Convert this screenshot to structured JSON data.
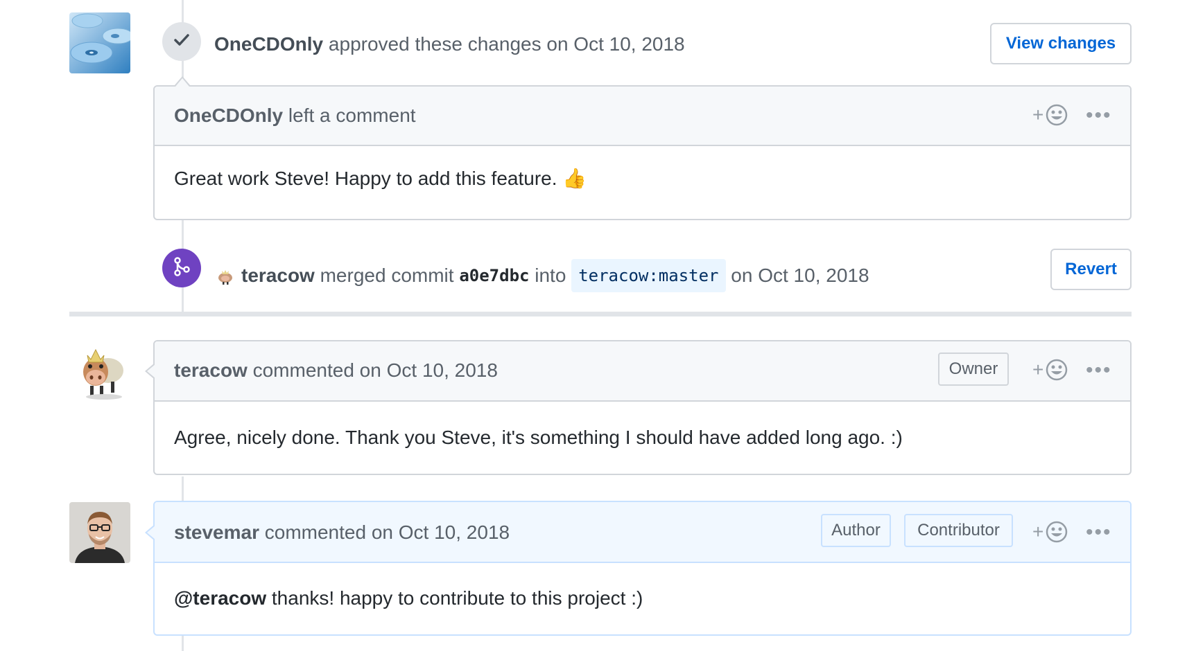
{
  "review": {
    "user": "OneCDOnly",
    "action_text": "approved these changes on Oct 10, 2018",
    "view_changes_label": "View changes"
  },
  "review_comment": {
    "user": "OneCDOnly",
    "head_text": "left a comment",
    "body": "Great work Steve! Happy to add this feature.",
    "emoji": "👍"
  },
  "merge_event": {
    "user": "teracow",
    "text_merged": "merged commit",
    "sha": "a0e7dbc",
    "text_into": "into",
    "branch": "teracow:master",
    "date_text": "on Oct 10, 2018",
    "revert_label": "Revert"
  },
  "comments": [
    {
      "user": "teracow",
      "meta": "commented on Oct 10, 2018",
      "labels": [
        "Owner"
      ],
      "body": "Agree, nicely done. Thank you Steve, it's something I should have added long ago. :)"
    },
    {
      "user": "stevemar",
      "meta": "commented on Oct 10, 2018",
      "labels": [
        "Author",
        "Contributor"
      ],
      "mention": "@teracow",
      "body": "thanks! happy to contribute to this project :)"
    }
  ],
  "icons": {
    "reaction": "add-reaction-icon",
    "more": "more-options-icon",
    "check": "check-icon",
    "merge": "merge-icon"
  },
  "colors": {
    "link": "#0366d6",
    "merge_purple": "#6f42c1",
    "timeline": "#e1e4e8"
  },
  "ui": {
    "plus": "+",
    "dots": "•••"
  }
}
